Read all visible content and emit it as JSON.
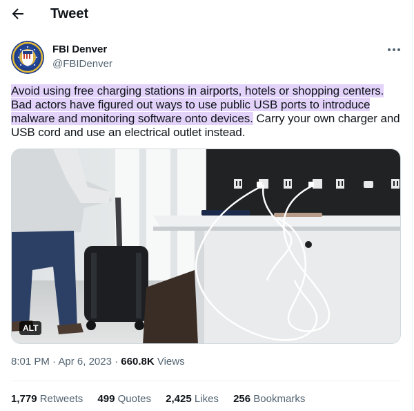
{
  "header": {
    "title": "Tweet",
    "back_icon": "arrow-left-icon"
  },
  "author": {
    "name": "FBI Denver",
    "handle": "@FBIDenver",
    "avatar_icon": "fbi-seal-icon",
    "more_icon": "more-horizontal-icon"
  },
  "tweet": {
    "highlighted_text": "Avoid using free charging stations in airports, hotels or shopping centers. Bad actors have figured out ways to use public USB ports to introduce malware and monitoring software onto devices.",
    "plain_text": " Carry your own charger and USB cord and use an electrical outlet instead.",
    "highlight_color": "#e3d3fb"
  },
  "media": {
    "alt_badge": "ALT"
  },
  "meta": {
    "time": "8:01 PM",
    "separator": "·",
    "date": "Apr 6, 2023",
    "views_count": "660.8K",
    "views_label": "Views"
  },
  "stats": [
    {
      "count": "1,779",
      "label": "Retweets"
    },
    {
      "count": "499",
      "label": "Quotes"
    },
    {
      "count": "2,425",
      "label": "Likes"
    },
    {
      "count": "256",
      "label": "Bookmarks"
    }
  ],
  "colors": {
    "text": "#0f1419",
    "secondary": "#536471",
    "divider": "#eff3f4"
  }
}
